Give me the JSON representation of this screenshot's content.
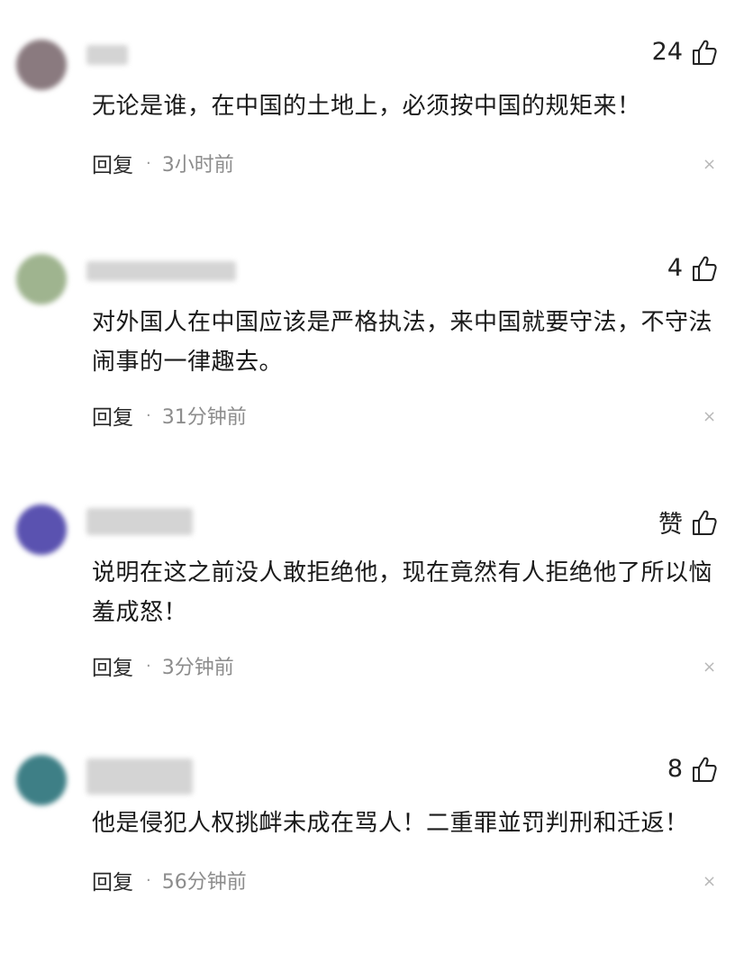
{
  "comments": [
    {
      "likes": "24",
      "text": "无论是谁，在中国的土地上，必须按中国的规矩来！",
      "reply": "回复",
      "time": "3小时前",
      "avatar_color": "#8a7a7f"
    },
    {
      "likes": "4",
      "text": "对外国人在中国应该是严格执法，来中国就要守法，不守法闹事的一律趣去。",
      "reply": "回复",
      "time": "31分钟前",
      "avatar_color": "#9fb48f"
    },
    {
      "likes": "赞",
      "text": "说明在这之前没人敢拒绝他，现在竟然有人拒绝他了所以恼羞成怒！",
      "reply": "回复",
      "time": "3分钟前",
      "avatar_color": "#5a52b0"
    },
    {
      "likes": "8",
      "text": "他是侵犯人权挑衅未成在骂人！二重罪並罚判刑和迁返！",
      "reply": "回复",
      "time": "56分钟前",
      "avatar_color": "#3e7f86"
    }
  ],
  "icons": {
    "like": "thumbs-up-icon",
    "close": "close-icon"
  }
}
